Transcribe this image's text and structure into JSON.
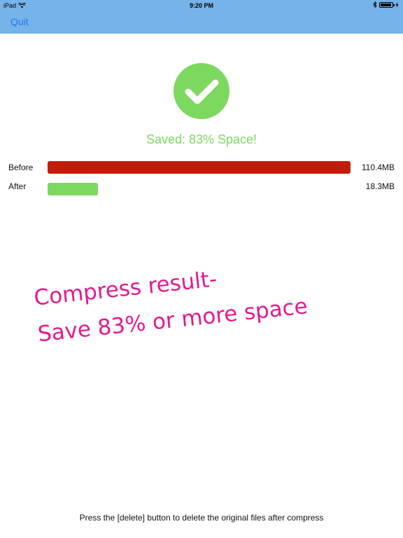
{
  "status_bar": {
    "device": "iPad",
    "time": "9:20 PM"
  },
  "nav": {
    "quit_label": "Quit"
  },
  "result": {
    "saved_text": "Saved: 83% Space!",
    "success_color": "#7dd860"
  },
  "comparison": [
    {
      "label": "Before",
      "size": "110.4MB",
      "fill_fraction": 1.0,
      "color": "#c21d0a"
    },
    {
      "label": "After",
      "size": "18.3MB",
      "fill_fraction": 0.166,
      "color": "#7dd860"
    }
  ],
  "promo": {
    "line1": "Compress result-",
    "line2": "Save 83% or more space",
    "color": "#e6198f"
  },
  "footer": {
    "note": "Press the [delete] button to delete the original files after compress"
  },
  "colors": {
    "nav_bar": "#76b3e9",
    "link": "#1a7cf3"
  },
  "icons": {
    "wifi": "wifi-icon",
    "bluetooth": "bluetooth-icon",
    "battery": "battery-icon",
    "success": "checkmark-icon"
  }
}
